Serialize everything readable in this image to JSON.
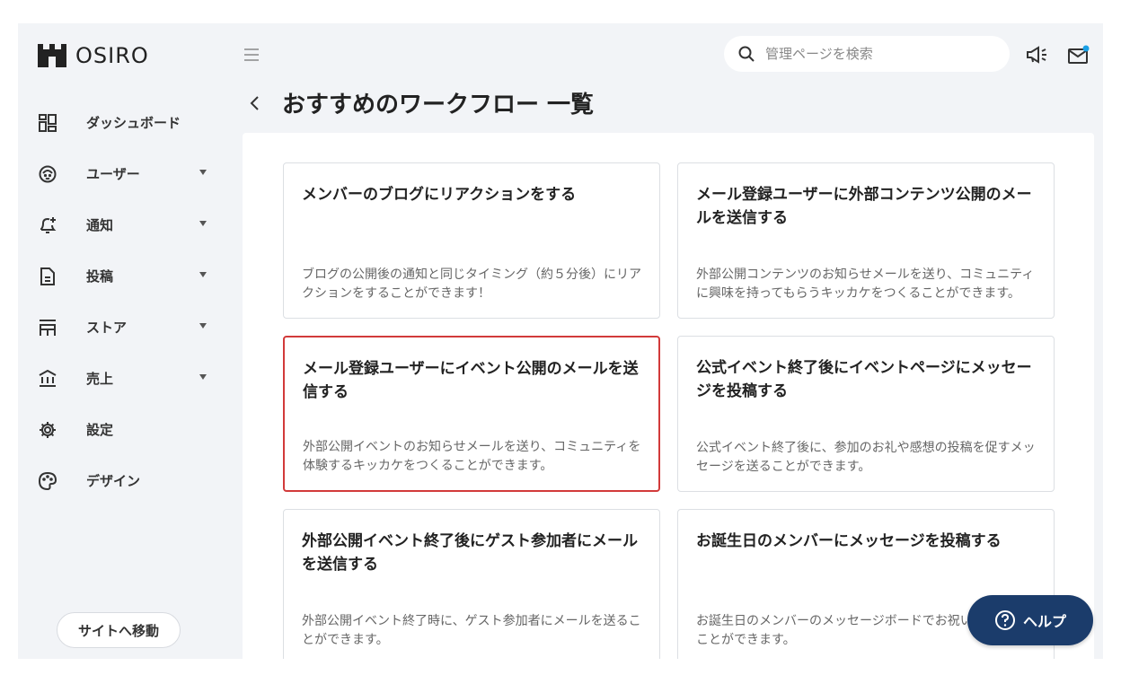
{
  "brand": {
    "name": "OSIRO"
  },
  "sidebar": {
    "items": [
      {
        "label": "ダッシュボード",
        "icon": "dashboard-icon",
        "has_caret": false
      },
      {
        "label": "ユーザー",
        "icon": "user-icon",
        "has_caret": true
      },
      {
        "label": "通知",
        "icon": "bell-icon",
        "has_caret": true
      },
      {
        "label": "投稿",
        "icon": "document-icon",
        "has_caret": true
      },
      {
        "label": "ストア",
        "icon": "store-icon",
        "has_caret": true
      },
      {
        "label": "売上",
        "icon": "bank-icon",
        "has_caret": true
      },
      {
        "label": "設定",
        "icon": "gear-icon",
        "has_caret": false
      },
      {
        "label": "デザイン",
        "icon": "palette-icon",
        "has_caret": false
      }
    ],
    "site_button": "サイトへ移動"
  },
  "header": {
    "search_placeholder": "管理ページを検索",
    "notification_dot_color": "#1aa0e6"
  },
  "page": {
    "title": "おすすめのワークフロー 一覧"
  },
  "cards": [
    {
      "title": "メンバーのブログにリアクションをする",
      "desc": "ブログの公開後の通知と同じタイミング（約５分後）にリアクションをすることができます！"
    },
    {
      "title": "メール登録ユーザーに外部コンテンツ公開のメールを送信する",
      "desc": "外部公開コンテンツのお知らせメールを送り、コミュニティに興味を持ってもらうキッカケをつくることができます。"
    },
    {
      "title": "メール登録ユーザーにイベント公開のメールを送信する",
      "desc": "外部公開イベントのお知らせメールを送り、コミュニティを体験するキッカケをつくることができます。"
    },
    {
      "title": "公式イベント終了後にイベントページにメッセージを投稿する",
      "desc": "公式イベント終了後に、参加のお礼や感想の投稿を促すメッセージを送ることができます。"
    },
    {
      "title": "外部公開イベント終了後にゲスト参加者にメールを送信する",
      "desc": "外部公開イベント終了時に、ゲスト参加者にメールを送ることができます。"
    },
    {
      "title": "お誕生日のメンバーにメッセージを投稿する",
      "desc": "お誕生日のメンバーのメッセージボードでお祝いの投稿することができます。"
    }
  ],
  "help_button": "ヘルプ",
  "colors": {
    "active_border": "#d23a3a",
    "help_bg": "#1b3c6b"
  }
}
